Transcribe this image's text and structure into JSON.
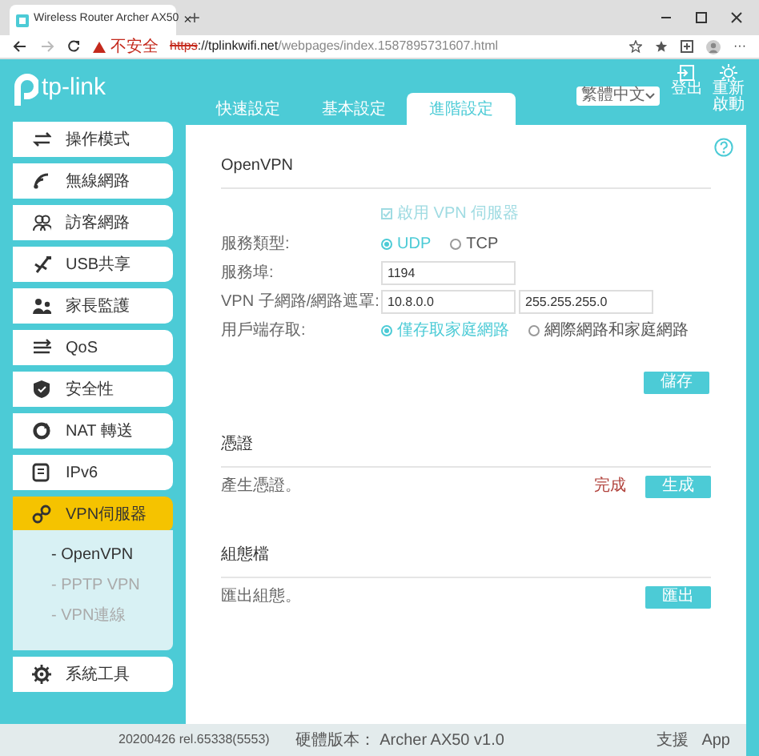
{
  "browser": {
    "tab_title": "Wireless Router Archer AX50",
    "tab_close": "×",
    "new_tab": "+",
    "warning": "不安全",
    "url_scheme": "https",
    "url_host": "://tplinkwifi.net",
    "url_path": "/webpages/index.1587895731607.html",
    "more": "···"
  },
  "header": {
    "logo": "tp-link",
    "tabs": [
      {
        "label": "快速設定",
        "selected": false
      },
      {
        "label": "基本設定",
        "selected": false
      },
      {
        "label": "進階設定",
        "selected": true
      }
    ],
    "language": "繁體中文",
    "actions": [
      {
        "label": "登出"
      },
      {
        "label": "重新啟動"
      }
    ]
  },
  "sidebar": {
    "items": [
      {
        "label": "操作模式",
        "selected": false
      },
      {
        "label": "無線網路",
        "selected": false
      },
      {
        "label": "訪客網路",
        "selected": false
      },
      {
        "label": "USB共享",
        "selected": false
      },
      {
        "label": "家長監護",
        "selected": false
      },
      {
        "label": "QoS",
        "selected": false
      },
      {
        "label": "安全性",
        "selected": false
      },
      {
        "label": "NAT 轉送",
        "selected": false
      },
      {
        "label": "IPv6",
        "selected": false
      },
      {
        "label": "VPN伺服器",
        "selected": true,
        "children": [
          {
            "label": "- OpenVPN",
            "selected": true
          },
          {
            "label": "- PPTP VPN",
            "selected": false
          },
          {
            "label": "- VPN連線",
            "selected": false
          }
        ]
      },
      {
        "label": "系統工具",
        "selected": false
      }
    ]
  },
  "main": {
    "title": "OpenVPN",
    "enable": {
      "label": "啟用 VPN 伺服器",
      "checked": true
    },
    "fields": [
      {
        "kind": "radio",
        "label": "服務類型:",
        "options": [
          {
            "label": "UDP",
            "selected": true
          },
          {
            "label": "TCP",
            "selected": false
          }
        ]
      },
      {
        "kind": "input",
        "label": "服務埠:",
        "values": [
          "1194"
        ]
      },
      {
        "kind": "input",
        "label": "VPN 子網路/網路遮罩:",
        "values": [
          "10.8.0.0",
          "255.255.255.0"
        ]
      },
      {
        "kind": "radio",
        "label": "用戶端存取:",
        "options": [
          {
            "label": "僅存取家庭網路",
            "selected": true
          },
          {
            "label": "網際網路和家庭網路",
            "selected": false
          }
        ]
      }
    ],
    "save": "儲存",
    "sections": [
      {
        "title": "憑證",
        "label": "產生憑證。",
        "status": "完成",
        "button": "生成"
      },
      {
        "title": "組態檔",
        "label": "匯出組態。",
        "button": "匯出"
      }
    ]
  },
  "footer": {
    "firmware": "20200426 rel.65338(5553)",
    "hardware": "硬體版本： Archer AX50 v1.0",
    "links": [
      "支援",
      "App"
    ]
  }
}
